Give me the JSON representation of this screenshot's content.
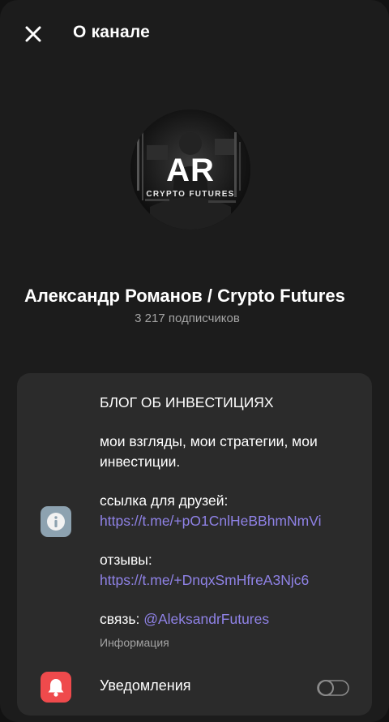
{
  "header": {
    "title": "О канале"
  },
  "channel": {
    "avatar_monogram": "AR",
    "avatar_subtitle": "CRYPTO FUTURES",
    "name": "Александр Романов / Crypto Futures",
    "subscribers": "3 217 подписчиков"
  },
  "about": {
    "heading": "БЛОГ ОБ ИНВЕСТИЦИЯХ",
    "tagline": "мои взгляды, мои стратегии, мои инвестиции.",
    "friends_label": "ссылка для друзей: ",
    "friends_link": "https://t.me/+pO1CnlHeBBhmNmVi",
    "reviews_label": "отзывы: ",
    "reviews_link": "https://t.me/+DnqxSmHfreA3Njc6",
    "contact_label": "связь: ",
    "contact_link": "@AleksandrFutures",
    "info_label": "Информация",
    "info_icon": "info-icon"
  },
  "notifications": {
    "label": "Уведомления",
    "icon": "bell-icon",
    "enabled": false
  },
  "colors": {
    "background": "#1c1c1c",
    "card": "#2b2b2b",
    "link": "#8f82e6",
    "info_icon_bg": "#8da2b0",
    "bell_icon_bg": "#ef4a4c",
    "muted_text": "#a4a4a4"
  }
}
